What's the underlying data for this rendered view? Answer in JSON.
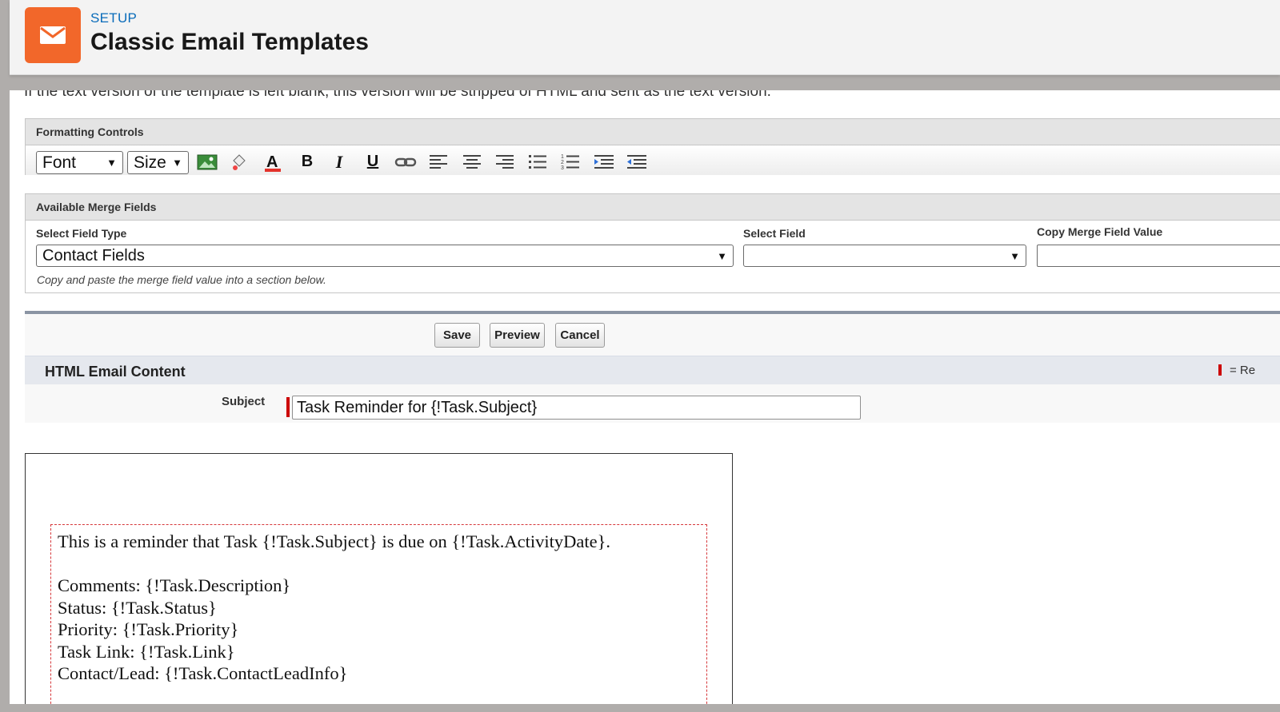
{
  "header": {
    "eyebrow": "SETUP",
    "title": "Classic Email Templates",
    "icon": "email-icon",
    "brand_color": "#f2672a"
  },
  "intro_text": "If the text version of the template is left blank, this version will be stripped of HTML and sent as the text version.",
  "formatting": {
    "title": "Formatting Controls",
    "font_select": "Font",
    "size_select": "Size",
    "tools": [
      "insert-image-icon",
      "background-color-icon",
      "text-color-icon",
      "bold-icon",
      "italic-icon",
      "underline-icon",
      "link-icon",
      "align-left-icon",
      "align-center-icon",
      "align-right-icon",
      "bullet-list-icon",
      "numbered-list-icon",
      "indent-icon",
      "outdent-icon"
    ]
  },
  "merge": {
    "title": "Available Merge Fields",
    "field_type_label": "Select Field Type",
    "field_type_value": "Contact Fields",
    "field_label": "Select Field",
    "field_value": "",
    "copy_label": "Copy Merge Field Value",
    "copy_value": "",
    "help": "Copy and paste the merge field value into a section below."
  },
  "buttons": {
    "save": "Save",
    "preview": "Preview",
    "cancel": "Cancel"
  },
  "content": {
    "section_title": "HTML Email Content",
    "required_legend": "= Re",
    "subject_label": "Subject",
    "subject_value": "Task Reminder for {!Task.Subject}",
    "body_lines": [
      "This is a reminder that Task {!Task.Subject} is due on {!Task.ActivityDate}.",
      "",
      "Comments: {!Task.Description}",
      "Status: {!Task.Status}",
      "Priority: {!Task.Priority}",
      "Task Link: {!Task.Link}",
      "Contact/Lead: {!Task.ContactLeadInfo}"
    ]
  }
}
